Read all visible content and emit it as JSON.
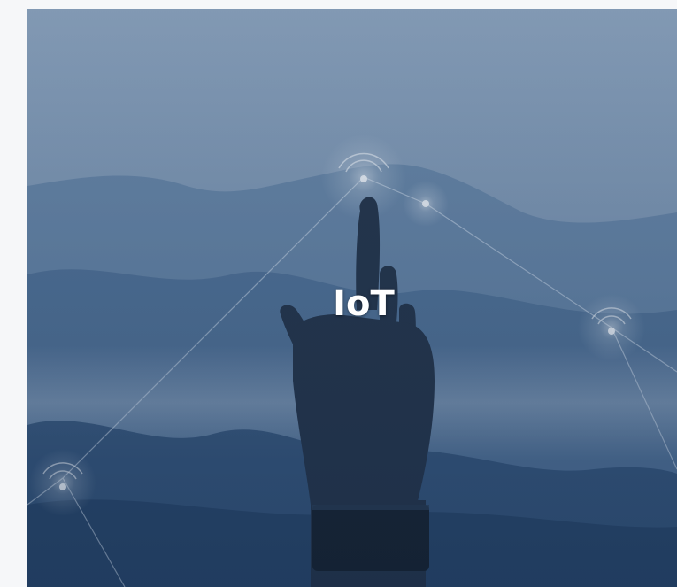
{
  "card": {
    "title": "IoT"
  },
  "colors": {
    "sky_top": "#8ea3bb",
    "sky_mid": "#7f96b0",
    "mountain_dark": "#2c4a6e",
    "hand": "#1f2c3e",
    "overlay": "#3b5f88",
    "title_text": "#ffffff"
  },
  "icons": {
    "signal_nodes": "wifi-signal-icon"
  }
}
